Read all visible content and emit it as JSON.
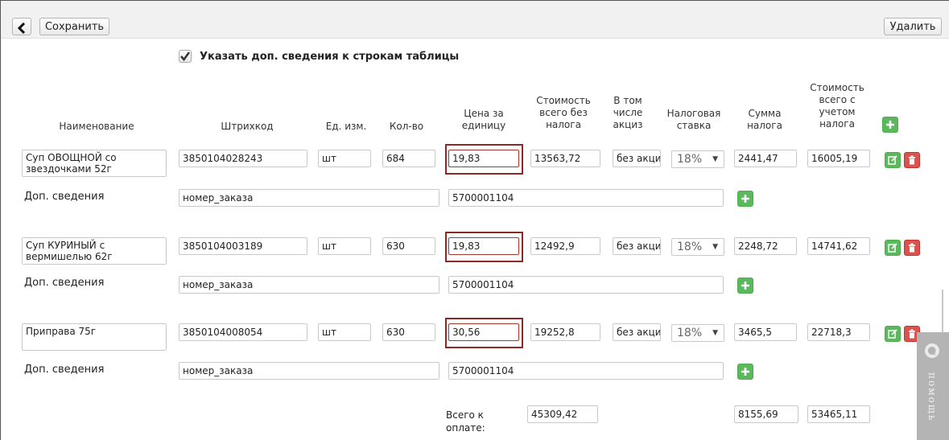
{
  "toolbar": {
    "save_label": "Сохранить",
    "delete_label": "Удалить"
  },
  "option": {
    "label": "Указать доп. сведения к строкам таблицы",
    "checked": true
  },
  "headers": {
    "name": "Наименование",
    "barcode": "Штрихкод",
    "unit": "Ед. изм.",
    "qty": "Кол-во",
    "price_l1": "Цена за",
    "price_l2": "единицу",
    "cost_l1": "Стоимость",
    "cost_l2": "всего без",
    "cost_l3": "налога",
    "excise_l1": "В том",
    "excise_l2": "числе",
    "excise_l3": "акциз",
    "rate_l1": "Налоговая",
    "rate_l2": "ставка",
    "tax_l1": "Сумма",
    "tax_l2": "налога",
    "total_l1": "Стоимость",
    "total_l2": "всего с",
    "total_l3": "учетом",
    "total_l4": "налога"
  },
  "rows": [
    {
      "name": "Суп ОВОЩНОЙ со звездочками 52г",
      "barcode": "3850104028243",
      "unit": "шт",
      "qty": "684",
      "price": "19,83",
      "cost": "13563,72",
      "excise": "без акциз",
      "rate": "18%",
      "tax": "2441,47",
      "total": "16005,19",
      "extra_label": "Доп. сведения",
      "extra_key": "номер_заказа",
      "extra_value": "5700001104"
    },
    {
      "name": "Суп КУРИНЫЙ с вермишелью 62г",
      "barcode": "3850104003189",
      "unit": "шт",
      "qty": "630",
      "price": "19,83",
      "cost": "12492,9",
      "excise": "без акциз",
      "rate": "18%",
      "tax": "2248,72",
      "total": "14741,62",
      "extra_label": "Доп. сведения",
      "extra_key": "номер_заказа",
      "extra_value": "5700001104"
    },
    {
      "name": "Приправа 75г",
      "barcode": "3850104008054",
      "unit": "шт",
      "qty": "630",
      "price": "30,56",
      "cost": "19252,8",
      "excise": "без акциз",
      "rate": "18%",
      "tax": "3465,5",
      "total": "22718,3",
      "extra_label": "Доп. сведения",
      "extra_key": "номер_заказа",
      "extra_value": "5700001104"
    }
  ],
  "summary": {
    "label_l1": "Всего к",
    "label_l2": "оплате:",
    "cost": "45309,42",
    "tax": "8155,69",
    "total": "53465,11"
  },
  "help": {
    "label": "помощь"
  },
  "colors": {
    "accent_green": "#5cb85c",
    "danger_red": "#d9534f",
    "price_highlight": "#8b2a23"
  }
}
